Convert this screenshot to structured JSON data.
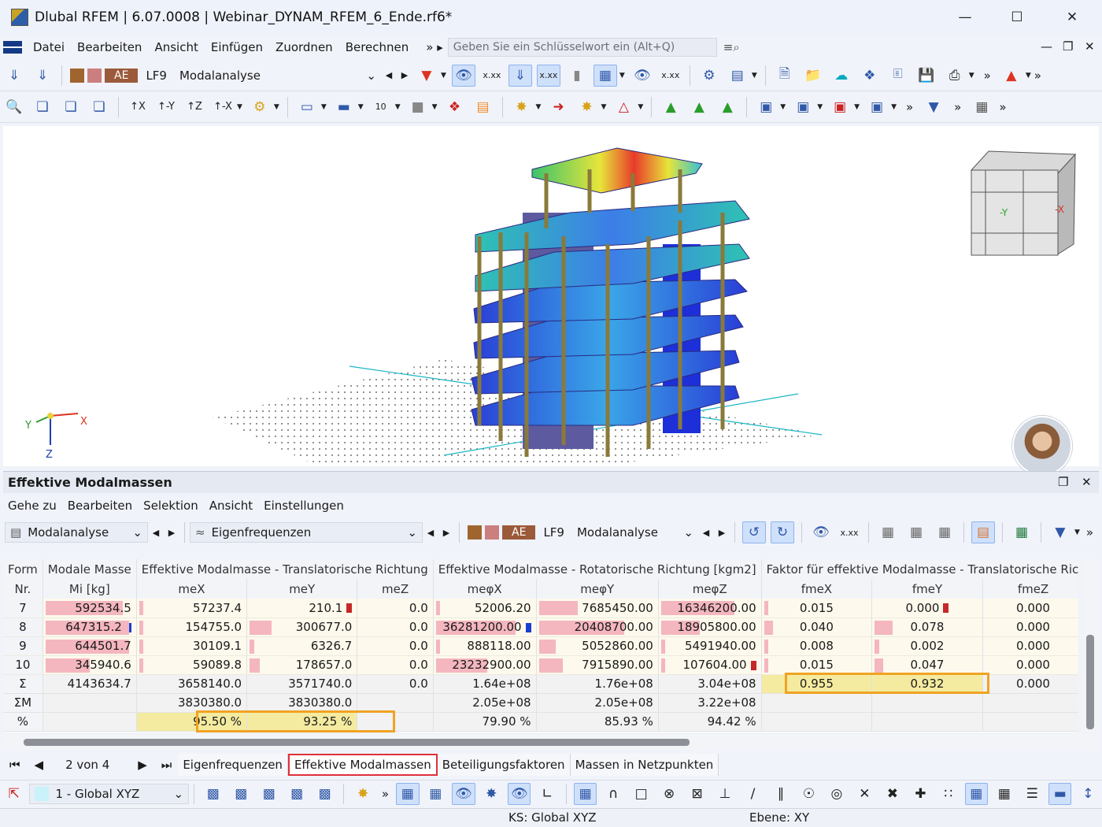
{
  "window": {
    "title": "Dlubal RFEM | 6.07.0008 | Webinar_DYNAM_RFEM_6_Ende.rf6*"
  },
  "menu": [
    "Datei",
    "Bearbeiten",
    "Ansicht",
    "Einfügen",
    "Zuordnen",
    "Berechnen"
  ],
  "search": {
    "placeholder": "Geben Sie ein Schlüsselwort ein (Alt+Q)"
  },
  "loadcase": {
    "tag": "AE",
    "code": "LF9",
    "name": "Modalanalyse"
  },
  "viewport": {
    "axis_x": "X",
    "axis_y": "Y",
    "axis_z": "Z",
    "cube_y": "-Y",
    "cube_x": "-X"
  },
  "panel": {
    "title": "Effektive Modalmassen",
    "menu": [
      "Gehe zu",
      "Bearbeiten",
      "Selektion",
      "Ansicht",
      "Einstellungen"
    ],
    "combo_analysis": "Modalanalyse",
    "combo_result": "Eigenfrequenzen",
    "lc_tag": "AE",
    "lc_code": "LF9",
    "lc_name": "Modalanalyse"
  },
  "table": {
    "group_headers": {
      "form": "Form",
      "modal_mass": "Modale Masse",
      "trans": "Effektive Modalmasse - Translatorische Richtung",
      "rot": "Effektive Modalmasse - Rotatorische Richtung [kgm2]",
      "factor": "Faktor für effektive Modalmasse - Translatorische Ric"
    },
    "sub_headers": {
      "form": "Nr.",
      "modal_mass": "Mi [kg]",
      "cols": [
        "meX",
        "meY",
        "meZ",
        "meφX",
        "meφY",
        "meφZ",
        "fmeX",
        "fmeY",
        "fmeZ"
      ]
    },
    "rows": [
      {
        "nr": "7",
        "mi": "592534.5",
        "mex": "57237.4",
        "mey": "210.1",
        "mez": "0.0",
        "mepx": "52006.20",
        "mepy": "7685450.00",
        "mepz": "16346200.00",
        "fmex": "0.015",
        "fmey": "0.000",
        "fmez": "0.000",
        "bars": [
          0.83,
          0.02,
          0.0,
          0.0,
          0.01,
          0.32,
          0.72,
          0.02,
          0.0,
          0.0
        ],
        "mk": {
          "mey": "#c62828",
          "fmey": "#c62828"
        }
      },
      {
        "nr": "8",
        "mi": "647315.2",
        "mex": "154755.0",
        "mey": "300677.0",
        "mez": "0.0",
        "mepx": "36281200.00",
        "mepy": "20408700.00",
        "mepz": "18905800.00",
        "fmex": "0.040",
        "fmey": "0.078",
        "fmez": "0.000",
        "bars": [
          0.9,
          0.04,
          0.2,
          0.0,
          0.78,
          0.7,
          0.38,
          0.08,
          0.16,
          0.0
        ],
        "mk": {
          "mi": "#1a3fd0",
          "mepx": "#1a3fd0"
        }
      },
      {
        "nr": "9",
        "mi": "644501.7",
        "mex": "30109.1",
        "mey": "6326.7",
        "mez": "0.0",
        "mepx": "888118.00",
        "mepy": "5052860.00",
        "mepz": "5491940.00",
        "fmex": "0.008",
        "fmey": "0.002",
        "fmez": "0.000",
        "bars": [
          0.9,
          0.01,
          0.01,
          0.0,
          0.02,
          0.14,
          0.01,
          0.01,
          0.01,
          0.0
        ],
        "mk": {}
      },
      {
        "nr": "10",
        "mi": "345940.6",
        "mex": "59089.8",
        "mey": "178657.0",
        "mez": "0.0",
        "mepx": "23232900.00",
        "mepy": "7915890.00",
        "mepz": "107604.00",
        "fmex": "0.015",
        "fmey": "0.047",
        "fmez": "0.000",
        "bars": [
          0.48,
          0.02,
          0.09,
          0.0,
          0.5,
          0.2,
          0.01,
          0.02,
          0.08,
          0.0
        ],
        "mk": {
          "mepz": "#c62828"
        }
      }
    ],
    "sum": {
      "label": "Σ",
      "mi": "4143634.7",
      "mex": "3658140.0",
      "mey": "3571740.0",
      "mez": "0.0",
      "mepx": "1.64e+08",
      "mepy": "1.76e+08",
      "mepz": "3.04e+08",
      "fmex": "0.955",
      "fmey": "0.932",
      "fmez": "0.000"
    },
    "sum_m": {
      "label": "ΣM",
      "mex": "3830380.0",
      "mey": "3830380.0",
      "mepx": "2.05e+08",
      "mepy": "2.05e+08",
      "mepz": "3.22e+08"
    },
    "pct": {
      "label": "%",
      "mex": "95.50",
      "mey": "93.25",
      "mepx": "79.90",
      "mepy": "85.93",
      "mepz": "94.42",
      "unit": "%"
    }
  },
  "tabs": {
    "pager": "2 von 4",
    "items": [
      "Eigenfrequenzen",
      "Effektive Modalmassen",
      "Beteiligungsfaktoren",
      "Massen in Netzpunkten"
    ]
  },
  "bottom": {
    "cs": "1 - Global XYZ"
  },
  "status": {
    "ks": "KS: Global XYZ",
    "ebene": "Ebene: XY"
  },
  "colors": {
    "accent": "#f0a323",
    "bar": "#f4b6bf",
    "active_tab": "#e0303a"
  }
}
